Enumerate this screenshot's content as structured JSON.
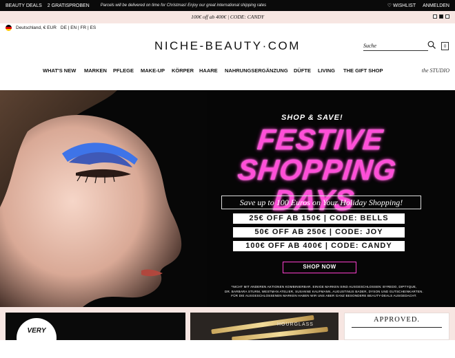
{
  "topbar": {
    "beauty_deals": "BEAUTY DEALS",
    "samples": "2 GRATISPROBEN",
    "message": "Parcels will be delivered on time for Christmas! Enjoy our great international shipping rates",
    "wishlist": "WISHLIST",
    "login": "ANMELDEN"
  },
  "promo": {
    "text": "100€ off ab 400€ | CODE: CANDY"
  },
  "locale": {
    "country": "Deutschland, € EUR",
    "languages": "DE | EN | FR | ES"
  },
  "logo": "NICHE-BEAUTY·COM",
  "search": {
    "placeholder": "Suche"
  },
  "cart": {
    "count": "0"
  },
  "nav": {
    "items": [
      "WHAT'S NEW",
      "MARKEN",
      "PFLEGE",
      "MAKE-UP",
      "KÖRPER",
      "HAARE",
      "NAHRUNGSERGÄNZUNG",
      "DÜFTE",
      "LIVING",
      "THE GIFT SHOP"
    ],
    "studio": "the STUDIO"
  },
  "hero": {
    "shop_save": "SHOP & SAVE!",
    "headline_1": "FESTIVE",
    "headline_2": "SHOPPING DAYS",
    "subline": "Save up to 100 Euros on Your Holiday Shopping!",
    "codes": [
      "25€ OFF AB 150€ | CODE: BELLS",
      "50€ OFF AB 250€ | CODE: JOY",
      "100€ OFF AB 400€ | CODE: CANDY"
    ],
    "button": "SHOP NOW",
    "fineprint": [
      "*NICHT MIT ANDEREN AKTIONEN KOMBINIERBAR. EINIGE MARKEN SIND AUSGESCHLOSSEN: BYREDO, DIPTYQUE,",
      "DR. BARBARA STURM, WESTMAN ATELIER, SUSANNE KAUFMANN, AUGUSTINUS BADER, DYSON UND GUTSCHEINKARTEN.",
      "FÜR DIE AUSGESCHLOSSENEN MARKEN HABEN WIR UNS ABER GANZ BESONDERE BEAUTY-DEALS AUSGEDACHT."
    ]
  },
  "tiles": {
    "very": "VERY",
    "hourglass": "HOURGLASS",
    "approved": "APPROVED."
  },
  "colors": {
    "accent": "#ff4fd8",
    "promo_bg": "#f7e6e2",
    "hero_bg": "#060606"
  }
}
